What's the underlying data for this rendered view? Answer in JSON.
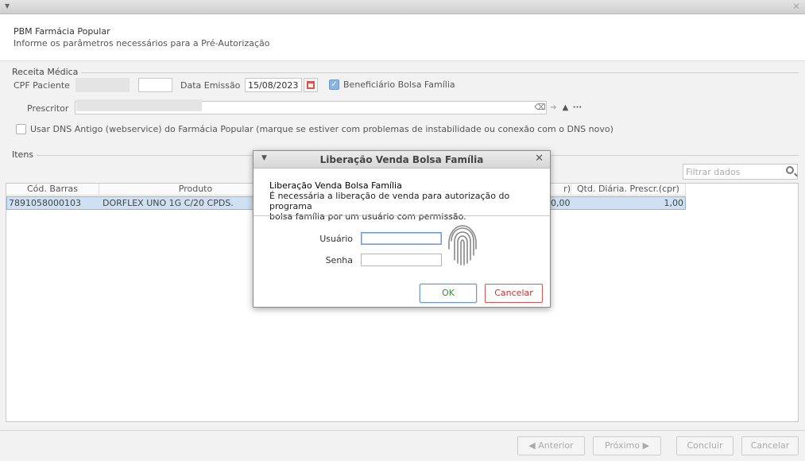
{
  "window": {
    "menu_icon": "chevron-down-icon",
    "close_icon": "close-icon"
  },
  "header": {
    "title": "PBM Farmácia Popular",
    "subtitle": "Informe os parâmetros necessários para a Pré-Autorização"
  },
  "receita": {
    "group_title": "Receita Médica",
    "cpf_label": "CPF Paciente",
    "cpf_value": "",
    "data_emissao_label": "Data Emissão",
    "data_emissao_value": "15/08/2023",
    "beneficiario_label": "Beneficiário Bolsa Família",
    "beneficiario_checked": true,
    "prescritor_label": "Prescritor",
    "prescritor_value": "",
    "dns_label": "Usar DNS Antigo (webservice) do Farmácia Popular (marque se estiver com problemas de instabilidade ou conexão com o DNS novo)",
    "dns_checked": false
  },
  "itens": {
    "group_title": "Itens",
    "filter_placeholder": "Filtrar dados",
    "columns": [
      "Cód. Barras",
      "Produto",
      "r)",
      "Qtd. Diária. Prescr.(cpr)"
    ],
    "rows": [
      {
        "cod_barras": "7891058000103",
        "produto": "DORFLEX UNO 1G C/20 CPDS.",
        "qtd_partial": "0,00",
        "qtd_diaria": "1,00"
      }
    ]
  },
  "footer": {
    "anterior": "Anterior",
    "proximo": "Próximo",
    "concluir": "Concluir",
    "cancelar": "Cancelar"
  },
  "dialog": {
    "title": "Liberação Venda Bolsa Família",
    "heading": "Liberação Venda Bolsa Família",
    "message_line1": "É necessária a liberação de venda para autorização do programa",
    "message_line2": "bolsa família por um usuário com permissão.",
    "usuario_label": "Usuário",
    "usuario_value": "",
    "senha_label": "Senha",
    "senha_value": "",
    "ok_label": "OK",
    "cancel_label": "Cancelar",
    "fingerprint_icon": "fingerprint-icon"
  },
  "colors": {
    "accent_blue": "#6d9ad0",
    "cancel_red": "#d9534f",
    "ok_green": "#3a8a3a",
    "row_selected": "#cfe0f3"
  }
}
